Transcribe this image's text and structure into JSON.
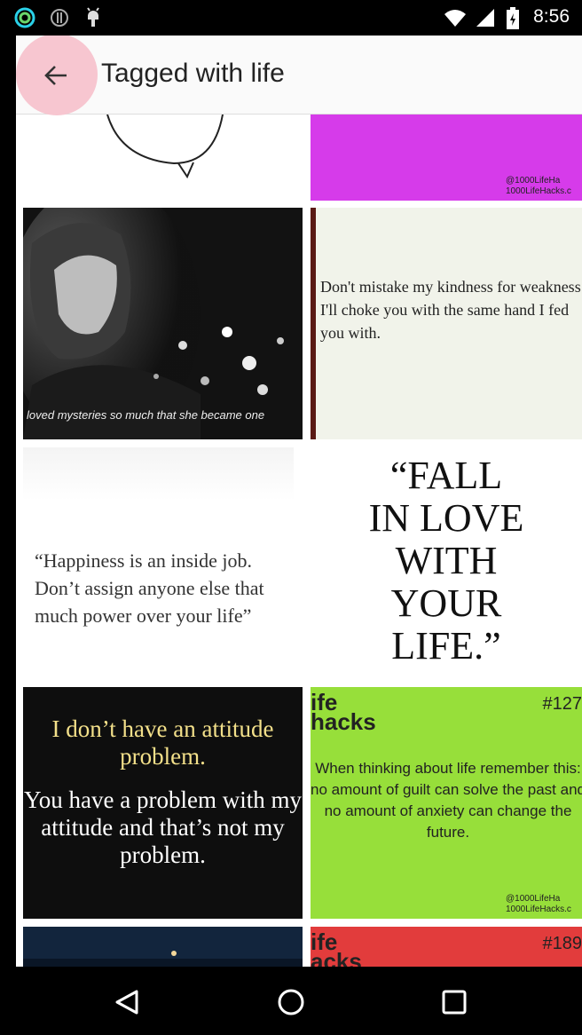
{
  "status_bar": {
    "time": "8:56",
    "icons": [
      "ring-app-icon",
      "info-circle-icon",
      "android-debug-icon",
      "wifi-icon",
      "signal-icon",
      "battery-icon"
    ]
  },
  "app_bar": {
    "back_icon": "arrow-left-icon",
    "title": "Tagged with life"
  },
  "tiles": {
    "t2": {
      "watermark": "@1000LifeHa\n1000LifeHacks.c"
    },
    "t3": {
      "caption": "loved mysteries so much that she became one"
    },
    "t4": {
      "quote": "Don't mistake my kindness for weakness. I'll choke you with the same hand I fed you with."
    },
    "t5": {
      "quote": "“Happiness is an inside job. Don’t assign anyone else that much power over your life”"
    },
    "t6": {
      "quote": "“FALL\nIN LOVE\nWITH\nYOUR\nLIFE.”"
    },
    "t7": {
      "line1": "I don’t have an attitude problem.",
      "line2": "You have a problem with my attitude and that’s not my problem."
    },
    "t8": {
      "logo": "ife\nhacks",
      "number": "#127",
      "text": "When thinking about life remember this: no amount of guilt can solve the past and no amount of anxiety can change the future.",
      "watermark": "@1000LifeHa\n1000LifeHacks.c"
    },
    "t10": {
      "logo": "ife\nacks",
      "number": "#189"
    }
  },
  "colors": {
    "magenta": "#d63bea",
    "green": "#97df3a",
    "red": "#e23c3c",
    "yellow_text": "#f3e08a",
    "accent_pink": "#f7c6d0"
  },
  "nav_bar": {
    "icons": [
      "back-triangle-icon",
      "home-circle-icon",
      "recents-square-icon"
    ]
  }
}
